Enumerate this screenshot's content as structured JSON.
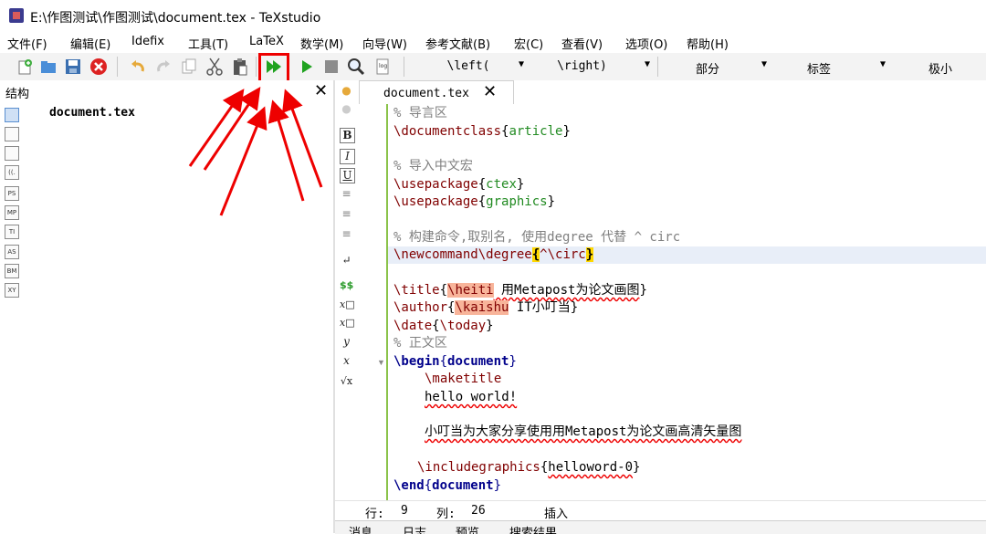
{
  "window": {
    "title": "E:\\作图测试\\作图测试\\document.tex - TeXstudio"
  },
  "menu": [
    "文件(F)",
    "编辑(E)",
    "Idefix",
    "工具(T)",
    "LaTeX",
    "数学(M)",
    "向导(W)",
    "参考文献(B)",
    "宏(C)",
    "查看(V)",
    "选项(O)",
    "帮助(H)"
  ],
  "toolbar": {
    "combos": [
      "\\left(",
      "\\right)",
      "部分",
      "标签",
      "极小"
    ],
    "icons": [
      "new-file-icon",
      "open-file-icon",
      "save-icon",
      "close-file-icon",
      "undo-icon",
      "redo-icon",
      "copy-icon",
      "cut-icon",
      "paste-icon",
      "build-and-view-icon",
      "compile-icon",
      "stop-icon",
      "view-pdf-icon",
      "view-log-icon"
    ]
  },
  "structure": {
    "title": "结构",
    "root": "document.tex",
    "side_icons": [
      "structure-icon",
      "bookmarks-icon",
      "symbols-icon",
      "brackets-icon",
      "pstricks-icon",
      "metapost-icon",
      "tikz-icon",
      "asymptote-icon",
      "beamer-icon",
      "xymatrix-icon"
    ]
  },
  "side_icon_labels": [
    "",
    "",
    "",
    "((.",
    "PS",
    "MP",
    "TI",
    "AS",
    "BM",
    "XY"
  ],
  "editor_tab": {
    "label": "document.tex"
  },
  "format_icons": [
    "B",
    "I",
    "U",
    "≡",
    "≡",
    "≡",
    "↵",
    "$$",
    "x□",
    "x□",
    "y",
    "x",
    "√x"
  ],
  "code": {
    "l1": "% 导言区",
    "l2_cmd": "\\documentclass",
    "l2_arg": "article",
    "l4": "% 导入中文宏",
    "l5_cmd": "\\usepackage",
    "l5_arg": "ctex",
    "l6_cmd": "\\usepackage",
    "l6_arg": "graphics",
    "l8": "% 构建命令,取别名, 使用degree 代替 ^ circ",
    "l9_cmd": "\\newcommand\\degree",
    "l9_arg": "^\\circ",
    "l11_cmd": "\\title",
    "l11_err": "\\heiti",
    "l11_text": " 用Metapost为论文画图",
    "l12_cmd": "\\author",
    "l12_err": "\\kaishu",
    "l12_text": " IT小叮当",
    "l13_cmd": "\\date",
    "l13_arg": "\\today",
    "l14": "% 正文区",
    "l15_cmd": "\\begin",
    "l15_arg": "document",
    "l16": "\\maketitle",
    "l17": "hello world!",
    "l19": "小叮当为大家分享使用用Metapost为论文画高清矢量图",
    "l21_cmd": "\\includegraphics",
    "l21_arg": "helloword-0",
    "l22_cmd": "\\end",
    "l22_arg": "document"
  },
  "status": {
    "row_label": "行:",
    "row": "9",
    "col_label": "列:",
    "col": "26",
    "mode": "插入"
  },
  "bottom_tabs": [
    "消息",
    "日志",
    "预览",
    "搜索结果"
  ],
  "colors": {
    "highlight": "#e00000",
    "comment": "#808080",
    "command": "#800000",
    "argument": "#228b22",
    "environment": "#00008b"
  }
}
